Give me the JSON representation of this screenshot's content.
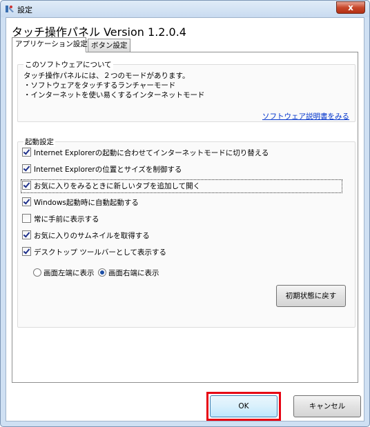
{
  "window": {
    "title": "設定",
    "close_label": "x"
  },
  "app": {
    "title": "タッチ操作パネル  Version 1.2.0.4"
  },
  "tabs": [
    {
      "label": "アプリケーション設定",
      "active": true
    },
    {
      "label": "ボタン設定",
      "active": false
    }
  ],
  "about": {
    "label": "このソフトウェアについて",
    "lines": [
      "タッチ操作パネルには、２つのモードがあります。",
      "・ソフトウェアをタッチするランチャーモード",
      "・インターネットを使い易くするインターネットモード"
    ],
    "manual_link": "ソフトウェア説明書をみる"
  },
  "startup": {
    "label": "起動設定",
    "options": [
      {
        "label": "Internet Explorerの起動に合わせてインターネットモードに切り替える",
        "checked": true
      },
      {
        "label": "Internet Explorerの位置とサイズを制御する",
        "checked": true
      },
      {
        "label": "お気に入りをみるときに新しいタブを追加して開く",
        "checked": true
      },
      {
        "label": "Windows起動時に自動起動する",
        "checked": true
      },
      {
        "label": "常に手前に表示する",
        "checked": false
      },
      {
        "label": "お気に入りのサムネイルを取得する",
        "checked": true
      },
      {
        "label": "デスクトップ ツールバーとして表示する",
        "checked": true
      }
    ],
    "radio_left": "画面左端に表示",
    "radio_right": "画面右端に表示",
    "radio_selected": "right",
    "reset_button": "初期状態に戻す"
  },
  "footer": {
    "ok": "OK",
    "cancel": "キャンセル"
  }
}
